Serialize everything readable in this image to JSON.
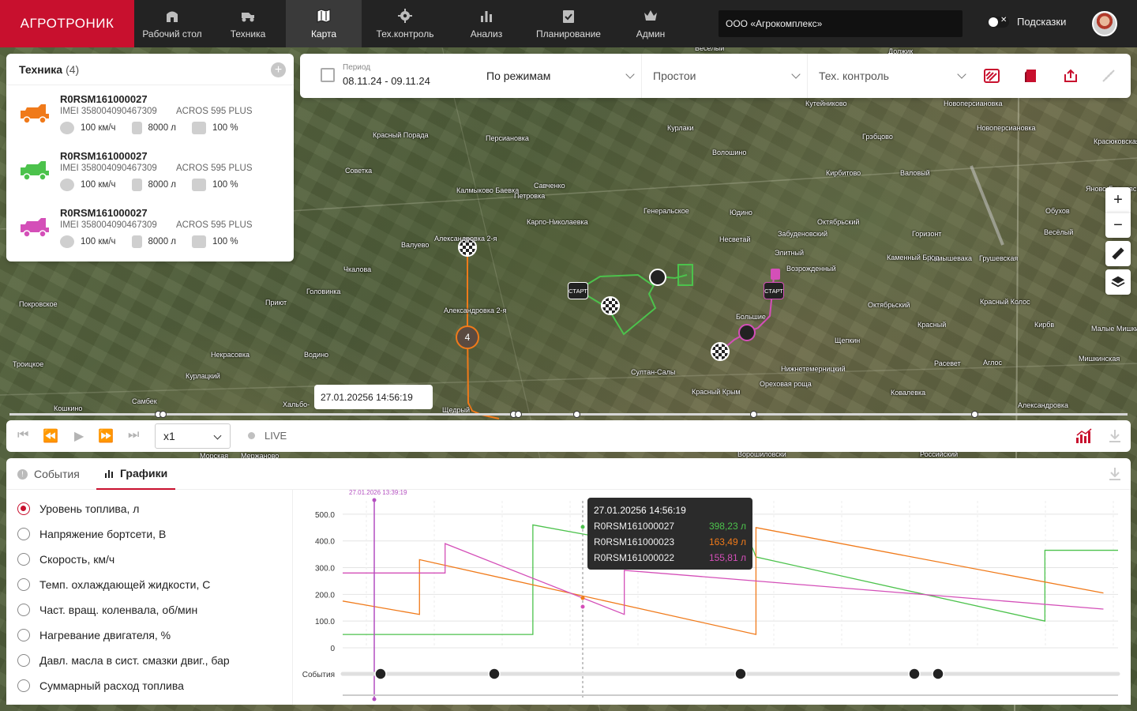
{
  "header": {
    "logo": "АГРОТРОНИК",
    "nav": [
      {
        "label": "Рабочий стол",
        "icon": "house-icon"
      },
      {
        "label": "Техника",
        "icon": "tractor-icon"
      },
      {
        "label": "Карта",
        "icon": "map-icon",
        "active": true
      },
      {
        "label": "Тех.контроль",
        "icon": "gear-icon"
      },
      {
        "label": "Анализ",
        "icon": "bar-chart-icon"
      },
      {
        "label": "Планирование",
        "icon": "clipboard-check-icon"
      },
      {
        "label": "Админ",
        "icon": "crown-icon"
      }
    ],
    "company": "ООО «Агрокомплекс»",
    "hints_label": "Подсказки"
  },
  "tech_panel": {
    "title": "Техника",
    "count": "(4)",
    "vehicles": [
      {
        "name": "R0RSM161000027",
        "imei": "IMEI 358004090467309",
        "model": "ACROS 595 PLUS",
        "speed": "100 км/ч",
        "fuel": "8000 л",
        "load": "100 %",
        "color": "#f07a1a"
      },
      {
        "name": "R0RSM161000027",
        "imei": "IMEI 358004090467309",
        "model": "ACROS 595 PLUS",
        "speed": "100 км/ч",
        "fuel": "8000 л",
        "load": "100 %",
        "color": "#4cc24c"
      },
      {
        "name": "R0RSM161000027",
        "imei": "IMEI 358004090467309",
        "model": "ACROS 595 PLUS",
        "speed": "100 км/ч",
        "fuel": "8000 л",
        "load": "100 %",
        "color": "#d44fb8"
      }
    ]
  },
  "filters": {
    "period_label": "Период",
    "period_value": "08.11.24 - 09.11.24",
    "mode": "По режимам",
    "idle": "Простои",
    "tech_control": "Тех. контроль"
  },
  "map": {
    "labels": [
      "Весёлый",
      "Дол­жик",
      "Кутейниково",
      "Новоперсиановка",
      "Курлаки",
      "Персиановка",
      "Грэбцово",
      "Новоперсиановка",
      "Красюковская",
      "Красный Порада",
      "Волошино",
      "Кирбитово",
      "Валовый",
      "Яново-Грушевск",
      "Советка",
      "Савченко",
      "Калмыково Баевка",
      "Петровка",
      "Генеральское",
      "Юдино",
      "Горизонт",
      "Обухов",
      "Весёлый",
      "Карпо-Николаевка",
      "Забуденовский",
      "Октябрьский",
      "Александровка 2-я",
      "Валуево",
      "Несветай",
      "Элитный",
      "Каменный Брод",
      "Камышевака",
      "Грушевская",
      "Чкалова",
      "Возрожденный",
      "Головинка",
      "Покровское",
      "Приют",
      "Александровка 2-я",
      "Большие",
      "Красный Колос",
      "Октябрьский",
      "Кирбв",
      "Малые Мишкин",
      "Красный",
      "Щепкин",
      "Расевет",
      "Аглос",
      "Некрасовка",
      "Водино",
      "Мишкинская",
      "Троицкое",
      "Курлацкий",
      "Султан-Салы",
      "Нижнетемерницкий",
      "Ореховая роща",
      "Красный Крым",
      "Ковалевка",
      "Самбек",
      "Кошкино",
      "Хальбо-",
      "Щедрый",
      "Александровка",
      "Морская",
      "Мержаново",
      "Ворошиловски",
      "Российский"
    ],
    "cluster_count": "4",
    "start_label": "СТАРТ",
    "time_tooltip": "27.01.20256 14:56:19"
  },
  "playback": {
    "speed": "x1",
    "live": "LIVE"
  },
  "bottom": {
    "tabs": [
      {
        "label": "События",
        "icon": "info-icon"
      },
      {
        "label": "Графики",
        "icon": "bar-chart-icon",
        "active": true
      }
    ],
    "params": [
      {
        "label": "Уровень топлива, л",
        "checked": true
      },
      {
        "label": "Напряжение бортсети, В",
        "checked": false
      },
      {
        "label": "Скорость, км/ч",
        "checked": false
      },
      {
        "label": "Темп. охлаждающей жидкости, С",
        "checked": false
      },
      {
        "label": "Част. вращ. коленвала, об/мин",
        "checked": false
      },
      {
        "label": "Нагревание двигателя, %",
        "checked": false
      },
      {
        "label": "Давл. масла в сист. смазки двиг., бар",
        "checked": false
      },
      {
        "label": "Суммарный расход топлива",
        "checked": false
      }
    ],
    "events_label": "События",
    "cursor_time": "27.01.2026 13:39:19",
    "tooltip": {
      "time": "27.01.20256 14:56:19",
      "rows": [
        {
          "name": "R0RSM161000027",
          "value": "398,23 л",
          "color": "#4cc24c"
        },
        {
          "name": "R0RSM161000023",
          "value": "163,49 л",
          "color": "#f07a1a"
        },
        {
          "name": "R0RSM161000022",
          "value": "155,81 л",
          "color": "#d44fb8"
        }
      ]
    }
  },
  "chart_data": {
    "type": "line",
    "title": "",
    "ylabel": "",
    "ylim": [
      0,
      550
    ],
    "yticks": [
      "500.0",
      "400.0",
      "300.0",
      "200.0",
      "100.0",
      "0"
    ],
    "series": [
      {
        "name": "R0RSM161000027",
        "color": "#4cc24c",
        "x": [
          0,
          260,
          260,
          360,
          560,
          565,
          960,
          960,
          1060
        ],
        "y": [
          50,
          50,
          460,
          410,
          375,
          340,
          100,
          365,
          365
        ]
      },
      {
        "name": "R0RSM161000023",
        "color": "#f07a1a",
        "x": [
          0,
          105,
          105,
          565,
          565,
          1040
        ],
        "y": [
          175,
          125,
          330,
          50,
          450,
          205
        ]
      },
      {
        "name": "R0RSM161000022",
        "color": "#d44fb8",
        "x": [
          0,
          140,
          140,
          385,
          385,
          1040
        ],
        "y": [
          280,
          280,
          390,
          125,
          290,
          145
        ]
      }
    ],
    "events": [
      "stop-icon",
      "refuel-icon",
      "stop-icon",
      "drain-icon",
      "refuel-icon"
    ]
  }
}
